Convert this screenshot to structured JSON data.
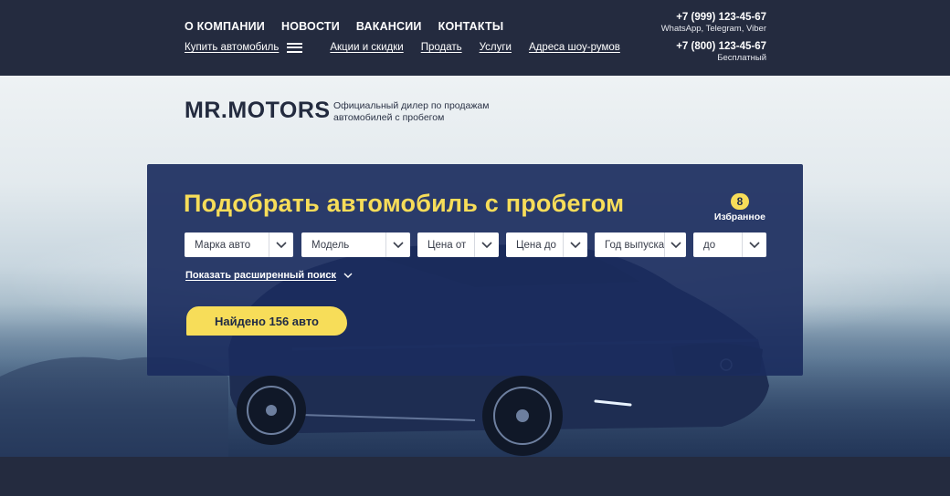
{
  "header": {
    "main_nav": [
      "О КОМПАНИИ",
      "НОВОСТИ",
      "ВАКАНСИИ",
      "КОНТАКТЫ"
    ],
    "sub_nav": {
      "buy": "Купить автомобиль",
      "items": [
        "Акции и скидки",
        "Продать",
        "Услуги",
        "Адреса шоу-румов"
      ]
    },
    "contacts": [
      {
        "phone": "+7 (999) 123-45-67",
        "note": "WhatsApp, Telegram, Viber"
      },
      {
        "phone": "+7 (800) 123-45-67",
        "note": "Бесплатный"
      }
    ]
  },
  "brand": {
    "logo": "MR.MOTORS",
    "tagline_line1": "Официальный дилер по продажам",
    "tagline_line2": "автомобилей с пробегом"
  },
  "search": {
    "title": "Подобрать автомобиль с пробегом",
    "favorites_count": "8",
    "favorites_label": "Избранное",
    "filters": [
      "Марка авто",
      "Модель",
      "Цена от",
      "Цена до",
      "Год выпуска",
      "до"
    ],
    "advanced_link": "Показать расширенный поиск",
    "found_button": "Найдено 156 авто"
  },
  "colors": {
    "accent": "#f7dd59",
    "header_bg": "#242b3f",
    "panel_bg": "#1b2d5e"
  },
  "icons": [
    "burger-menu-icon",
    "chevron-down-icon"
  ]
}
